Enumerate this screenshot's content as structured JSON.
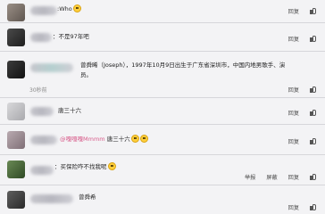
{
  "actions": {
    "reply": "回复",
    "report": "举报",
    "block": "屏蔽"
  },
  "comments": [
    {
      "text": ":Who",
      "has_emoji": true
    },
    {
      "text": "：不是97年吧"
    },
    {
      "text": "曾舜晞（Joseph），1997年10月9日出生于广东省深圳市，中国内地男歌手、演员。",
      "time": "30秒前"
    },
    {
      "text": "唐三十六"
    },
    {
      "mention": "@嘎嘎嘎Mmmm",
      "text": "唐三十六",
      "has_emoji": true
    },
    {
      "text": "：买保险咋不找我呢",
      "has_emoji": true
    },
    {
      "text": "曾舜希"
    }
  ]
}
